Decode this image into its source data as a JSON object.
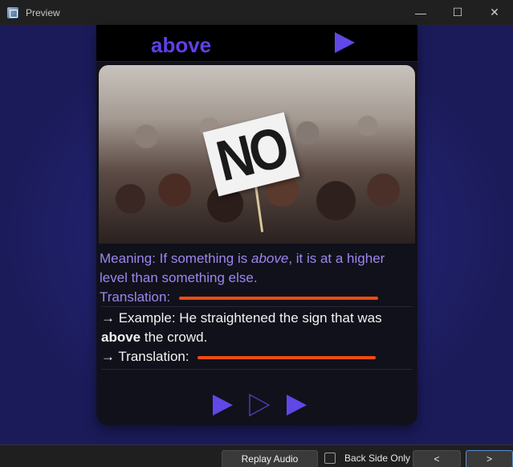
{
  "window": {
    "title": "Preview",
    "controls": [
      "—",
      "☐",
      "✕"
    ]
  },
  "card": {
    "word": "above",
    "meaning_prefix": "Meaning: If something is ",
    "meaning_italic": "above",
    "meaning_suffix": ", it is at a higher level than something else.",
    "translation_label": "Translation:",
    "example_prefix": "→ Example: He straightened the sign that was ",
    "example_bold": "above",
    "example_suffix": " the crowd.",
    "example_translation_label": "→ Translation:",
    "image": {
      "sign_text": "NO"
    }
  },
  "toolbar": {
    "replay_label": "Replay Audio",
    "back_side_label": "Back Side Only",
    "back_side_checked": false,
    "prev_label": "<",
    "next_label": ">"
  },
  "colors": {
    "accent": "#5f48e6",
    "word": "#6040e8",
    "meaning": "#9c86ee",
    "blank": "#ef4a12"
  }
}
